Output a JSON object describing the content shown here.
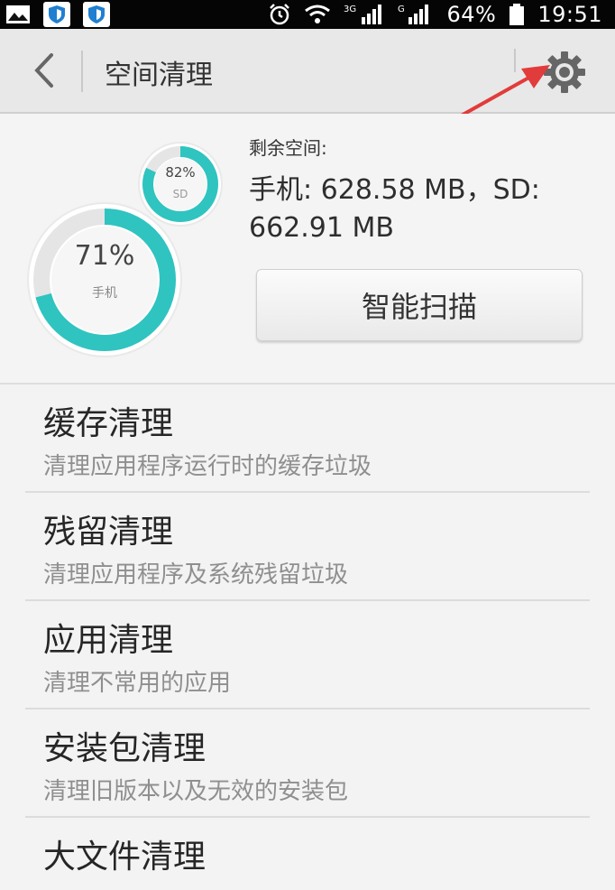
{
  "status_bar": {
    "battery_percent_label": "64%",
    "time": "19:51",
    "network_3g_label": "3G",
    "network_g_label": "G"
  },
  "action_bar": {
    "title": "空间清理"
  },
  "storage": {
    "phone_percent_label": "71%",
    "phone_percent": 71,
    "phone_label": "手机",
    "sd_percent_label": "82%",
    "sd_percent": 82,
    "sd_label": "SD",
    "remaining_label": "剩余空间:",
    "remaining_value": "手机: 628.58 MB，SD: 662.91 MB",
    "scan_button_label": "智能扫描"
  },
  "list": {
    "items": [
      {
        "title": "缓存清理",
        "subtitle": "清理应用程序运行时的缓存垃圾"
      },
      {
        "title": "残留清理",
        "subtitle": "清理应用程序及系统残留垃圾"
      },
      {
        "title": "应用清理",
        "subtitle": "清理不常用的应用"
      },
      {
        "title": "安装包清理",
        "subtitle": "清理旧版本以及无效的安装包"
      },
      {
        "title": "大文件清理"
      }
    ]
  },
  "colors": {
    "ring_teal": "#2fc4c0",
    "ring_blue": "#2a93d5",
    "arrow_red": "#e23b3b"
  }
}
